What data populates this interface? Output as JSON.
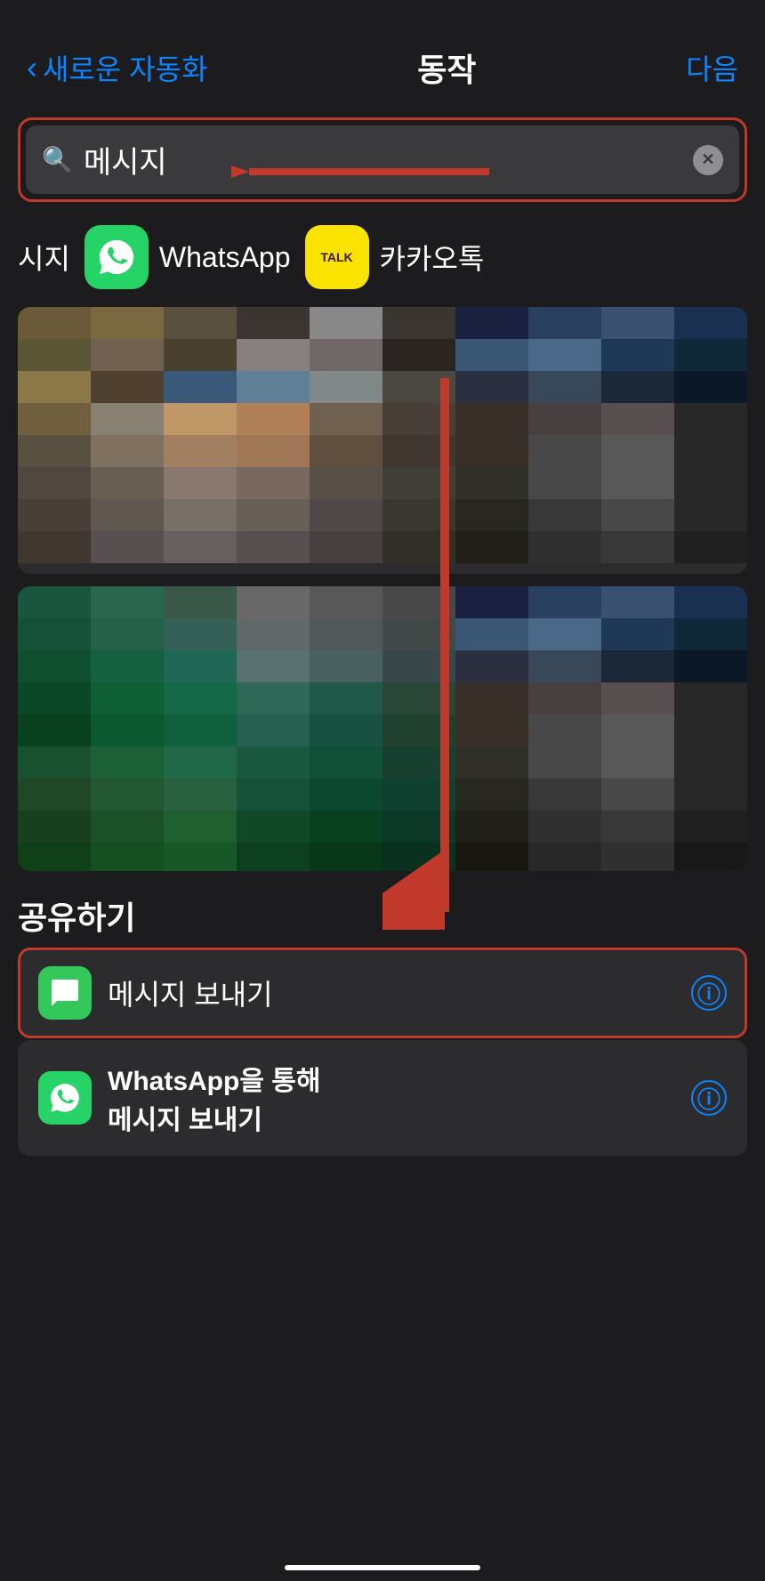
{
  "nav": {
    "back_label": "새로운 자동화",
    "title": "동작",
    "next_label": "다음"
  },
  "search": {
    "placeholder": "메시지",
    "value": "메시지",
    "clear_icon": "clear-icon"
  },
  "app_filters": [
    {
      "label": "시지",
      "app": "whatsapp",
      "name": "WhatsApp"
    },
    {
      "label": "카카오톡",
      "app": "kakaotalk",
      "name": "카카오톡"
    }
  ],
  "section_heading": "공유하기",
  "actions": [
    {
      "id": "send-message",
      "label": "메시지 보내기",
      "icon": "messages",
      "highlighted": true
    },
    {
      "id": "whatsapp-message",
      "label_line1": "WhatsApp을 통해",
      "label_line2": "메시지 보내기",
      "icon": "whatsapp",
      "highlighted": false
    }
  ]
}
